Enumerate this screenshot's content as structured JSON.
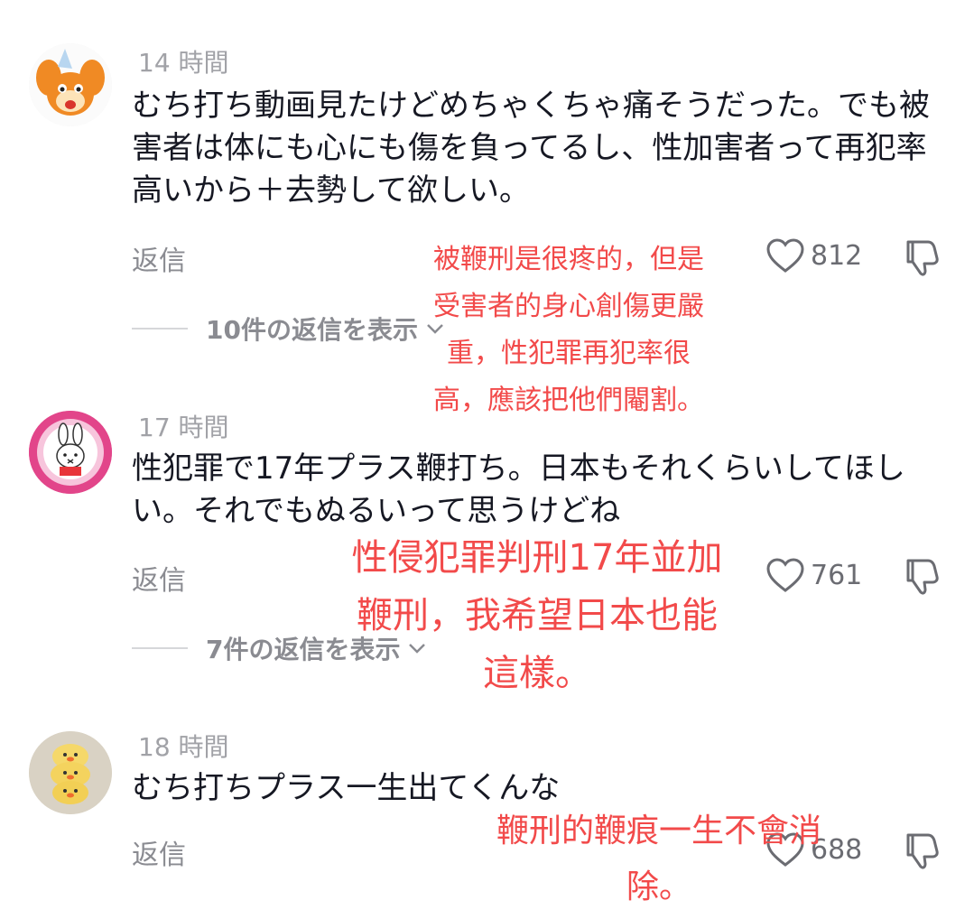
{
  "comments": [
    {
      "time": "14 時間",
      "text": "むち打ち動画見たけどめちゃくちゃ痛そうだった。でも被害者は体にも心にも傷を負ってるし、性加害者って再犯率高いから＋去勢して欲しい。",
      "reply_label": "返信",
      "likes": "812",
      "view_replies": "10件の返信を表示"
    },
    {
      "time": "17 時間",
      "text": "性犯罪で17年プラス鞭打ち。日本もそれくらいしてほしい。それでもぬるいって思うけどね",
      "reply_label": "返信",
      "likes": "761",
      "view_replies": "7件の返信を表示"
    },
    {
      "time": "18 時間",
      "text": "むち打ちプラス一生出てくんな",
      "reply_label": "返信",
      "likes": "688"
    }
  ],
  "annotations": [
    "被鞭刑是很疼的，但是\n受害者的身心創傷更嚴\n重，性犯罪再犯率很\n高，應該把他們閹割。",
    "性侵犯罪判刑17年並加\n鞭刑，我希望日本也能\n這樣。",
    "鞭刑的鞭痕一生不會消\n除。"
  ],
  "colors": {
    "annotation": "#f24a4a",
    "timestamp": "#a1a2a7",
    "text": "#161823"
  }
}
